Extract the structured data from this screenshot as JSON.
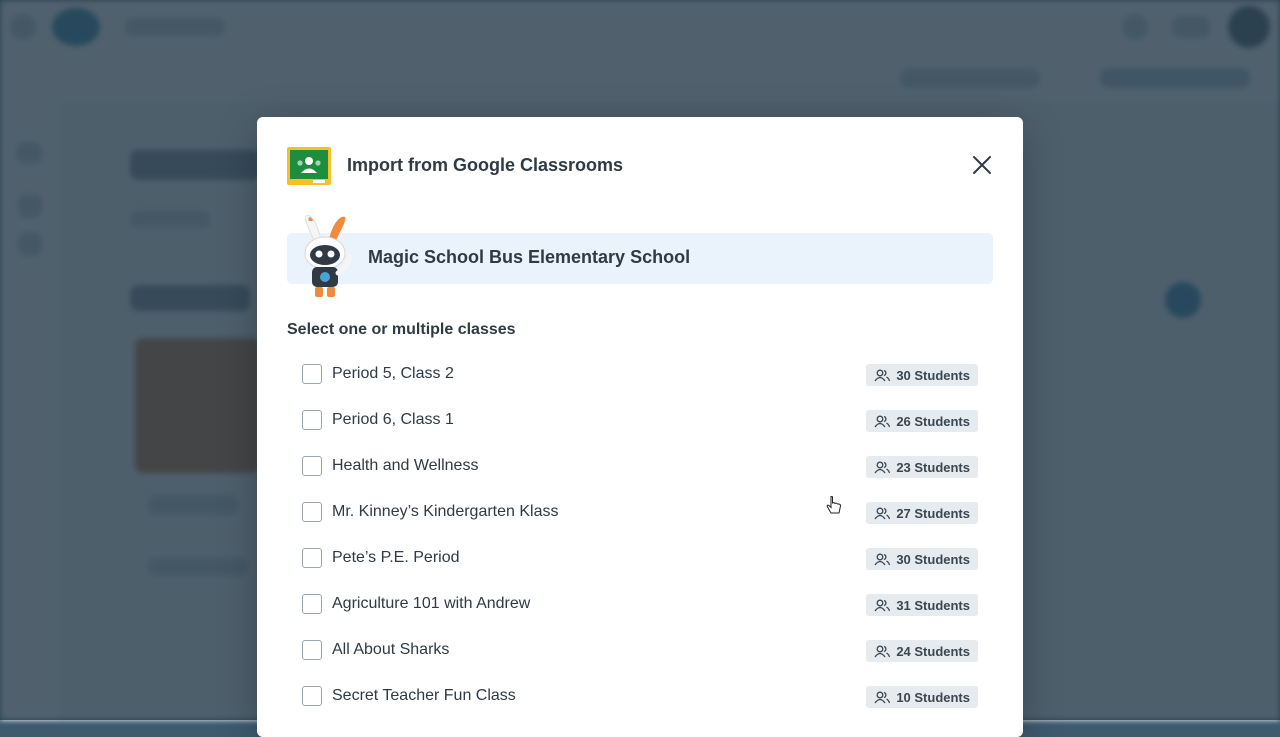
{
  "modal": {
    "title": "Import from Google Classrooms",
    "logo_icon": "google-classroom-icon",
    "close_icon": "close-icon",
    "school_name": "Magic School Bus Elementary School",
    "select_label": "Select one or multiple classes",
    "classes": [
      {
        "name": "Period 5, Class 2",
        "students": "30 Students",
        "checked": false
      },
      {
        "name": "Period 6, Class 1",
        "students": "26 Students",
        "checked": false
      },
      {
        "name": "Health and Wellness",
        "students": "23 Students",
        "checked": false
      },
      {
        "name": "Mr. Kinney’s Kindergarten Klass",
        "students": "27 Students",
        "checked": false
      },
      {
        "name": "Pete’s P.E. Period",
        "students": "30 Students",
        "checked": false
      },
      {
        "name": "Agriculture 101 with Andrew",
        "students": "31 Students",
        "checked": false
      },
      {
        "name": "All About Sharks",
        "students": "24 Students",
        "checked": false
      },
      {
        "name": "Secret Teacher Fun Class",
        "students": "10 Students",
        "checked": false
      }
    ]
  },
  "colors": {
    "overlay": "#1f3444",
    "banner": "#eaf3fb",
    "badge": "#e5ebef",
    "classroom_green": "#1e8e3e",
    "classroom_yellow": "#f6c026"
  }
}
